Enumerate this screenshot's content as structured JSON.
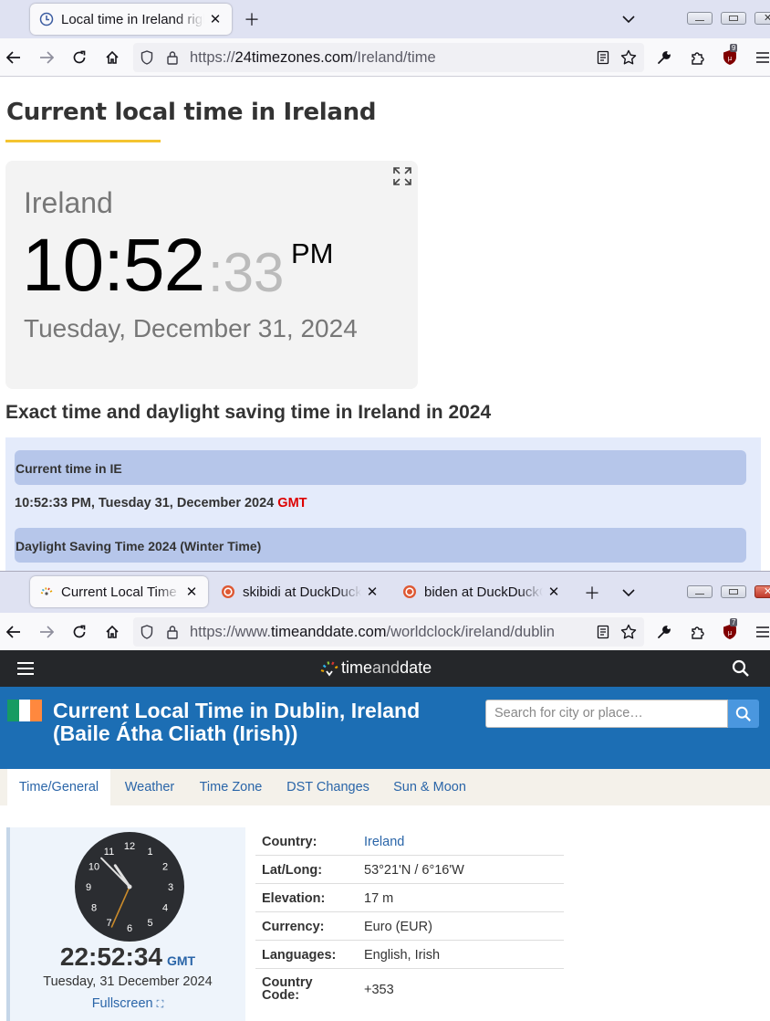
{
  "window1": {
    "tab": {
      "title": "Local time in Ireland right now"
    },
    "url": {
      "prefix": "https://",
      "host": "24timezones.com",
      "path": "/Ireland/time"
    },
    "extension_badge": "9",
    "page": {
      "title": "Current local time in Ireland",
      "clock": {
        "country": "Ireland",
        "hours_minutes": "10:52",
        "seconds": ":33",
        "ampm": "PM",
        "date": "Tuesday, December 31, 2024"
      },
      "section_heading": "Exact time and daylight saving time in Ireland in 2024",
      "info": {
        "current_label": "Current time in IE",
        "current_value": "10:52:33 PM, Tuesday 31, December 2024",
        "current_tz": "GMT",
        "dst_label": "Daylight Saving Time 2024 (Winter Time)"
      }
    },
    "colors": {
      "accent_underline": "#f4c430",
      "gmt": "#dd0000",
      "panel_bg": "#e4ebfb",
      "panel_head": "#b6c6ea"
    }
  },
  "window2": {
    "tabs": [
      {
        "title": "Current Local Time in Dublin, Ireland",
        "icon": "timeanddate-favicon"
      },
      {
        "title": "skibidi at DuckDuckGo",
        "icon": "duckduckgo-favicon"
      },
      {
        "title": "biden at DuckDuckGo",
        "icon": "duckduckgo-favicon"
      }
    ],
    "url": {
      "prefix": "https://www.",
      "host": "timeanddate.com",
      "path": "/worldclock/ireland/dublin"
    },
    "extension_badge": "7",
    "page": {
      "logo_text": {
        "a": "time",
        "b": "and",
        "c": "date"
      },
      "title_line1": "Current Local Time in Dublin, Ireland",
      "title_line2": "(Baile Átha Cliath (Irish))",
      "search_placeholder": "Search for city or place…",
      "nav_tabs": [
        "Time/General",
        "Weather",
        "Time Zone",
        "DST Changes",
        "Sun & Moon"
      ],
      "clock": {
        "time": "22:52:34",
        "zone": "GMT",
        "date": "Tuesday, 31 December 2024",
        "fullscreen": "Fullscreen",
        "dial": [
          "12",
          "1",
          "2",
          "3",
          "4",
          "5",
          "6",
          "7",
          "8",
          "9",
          "10",
          "11"
        ],
        "hour": 22,
        "minute": 52,
        "second": 34
      },
      "facts": [
        {
          "label": "Country:",
          "value": "Ireland",
          "link": true
        },
        {
          "label": "Lat/Long:",
          "value": "53°21'N / 6°16'W",
          "link": false
        },
        {
          "label": "Elevation:",
          "value": "17 m",
          "link": false
        },
        {
          "label": "Currency:",
          "value": "Euro (EUR)",
          "link": false
        },
        {
          "label": "Languages:",
          "value": "English, Irish",
          "link": false
        },
        {
          "label": "Country Code:",
          "value": "+353",
          "link": false
        }
      ]
    },
    "colors": {
      "header": "#25272a",
      "title_band": "#1c6eb4",
      "link": "#2a65a8",
      "tabs_bg": "#f4f1ea"
    }
  }
}
